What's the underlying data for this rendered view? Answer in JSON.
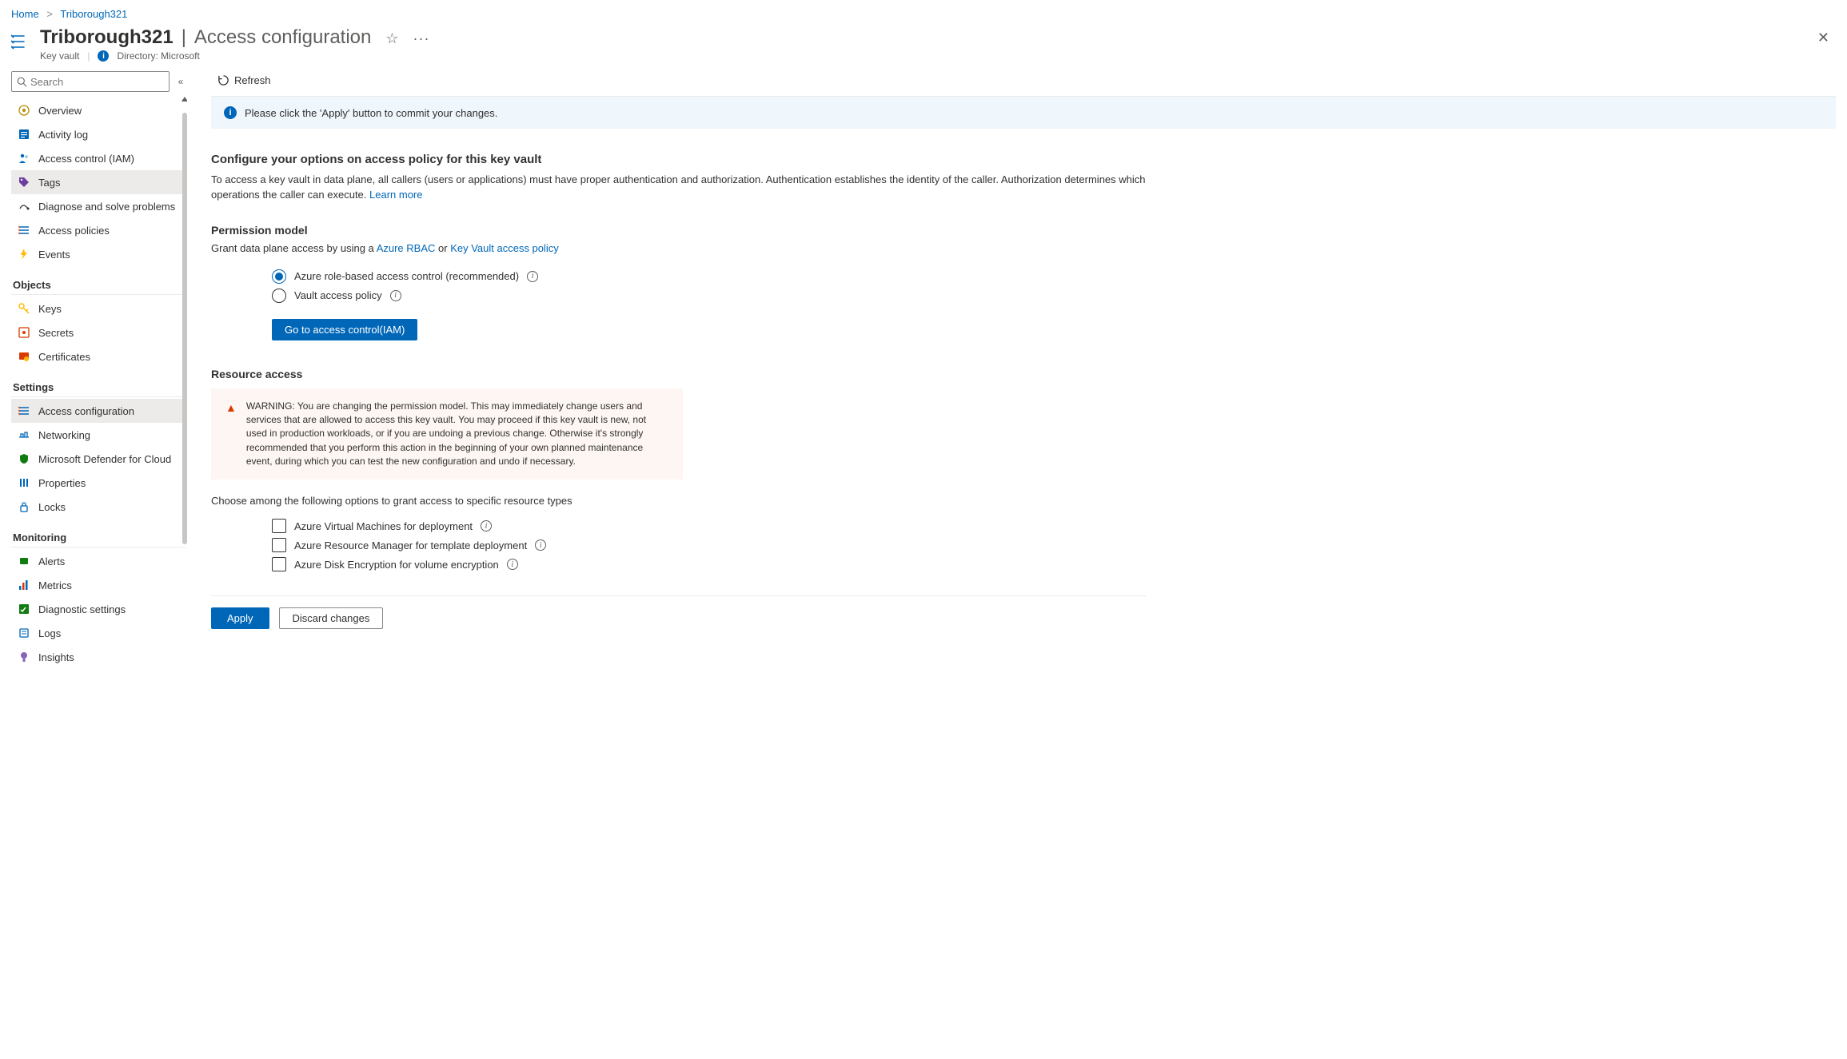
{
  "breadcrumb": {
    "home": "Home",
    "resource": "Triborough321"
  },
  "header": {
    "resource_name": "Triborough321",
    "page_name": "Access configuration",
    "resource_type": "Key vault",
    "directory_label": "Directory: Microsoft"
  },
  "search": {
    "placeholder": "Search"
  },
  "nav": {
    "items_top": [
      {
        "label": "Overview"
      },
      {
        "label": "Activity log"
      },
      {
        "label": "Access control (IAM)"
      },
      {
        "label": "Tags",
        "active": true
      },
      {
        "label": "Diagnose and solve problems"
      },
      {
        "label": "Access policies"
      },
      {
        "label": "Events"
      }
    ],
    "group_objects": "Objects",
    "items_objects": [
      {
        "label": "Keys"
      },
      {
        "label": "Secrets"
      },
      {
        "label": "Certificates"
      }
    ],
    "group_settings": "Settings",
    "items_settings": [
      {
        "label": "Access configuration",
        "active": true
      },
      {
        "label": "Networking"
      },
      {
        "label": "Microsoft Defender for Cloud"
      },
      {
        "label": "Properties"
      },
      {
        "label": "Locks"
      }
    ],
    "group_monitoring": "Monitoring",
    "items_monitoring": [
      {
        "label": "Alerts"
      },
      {
        "label": "Metrics"
      },
      {
        "label": "Diagnostic settings"
      },
      {
        "label": "Logs"
      },
      {
        "label": "Insights"
      }
    ]
  },
  "toolbar": {
    "refresh": "Refresh"
  },
  "info_banner": "Please click the 'Apply' button to commit your changes.",
  "config": {
    "heading": "Configure your options on access policy for this key vault",
    "desc": "To access a key vault in data plane, all callers (users or applications) must have proper authentication and authorization. Authentication establishes the identity of the caller. Authorization determines which operations the caller can execute. ",
    "learn_more": "Learn more"
  },
  "permission": {
    "heading": "Permission model",
    "desc_prefix": "Grant data plane access by using a ",
    "link_rbac": "Azure RBAC",
    "or": " or ",
    "link_policy": "Key Vault access policy",
    "opt_rbac": "Azure role-based access control (recommended)",
    "opt_policy": "Vault access policy",
    "goto_btn": "Go to access control(IAM)"
  },
  "resource_access": {
    "heading": "Resource access",
    "warning": "WARNING: You are changing the permission model. This may immediately change users and services that are allowed to access this key vault. You may proceed if this key vault is new, not used in production workloads, or if you are undoing a previous change. Otherwise it's strongly recommended that you perform this action in the beginning of your own planned maintenance event, during which you can test the new configuration and undo if necessary.",
    "choose_text": "Choose among the following options to grant access to specific resource types",
    "cb_vm": "Azure Virtual Machines for deployment",
    "cb_arm": "Azure Resource Manager for template deployment",
    "cb_disk": "Azure Disk Encryption for volume encryption"
  },
  "footer": {
    "apply": "Apply",
    "discard": "Discard changes"
  }
}
